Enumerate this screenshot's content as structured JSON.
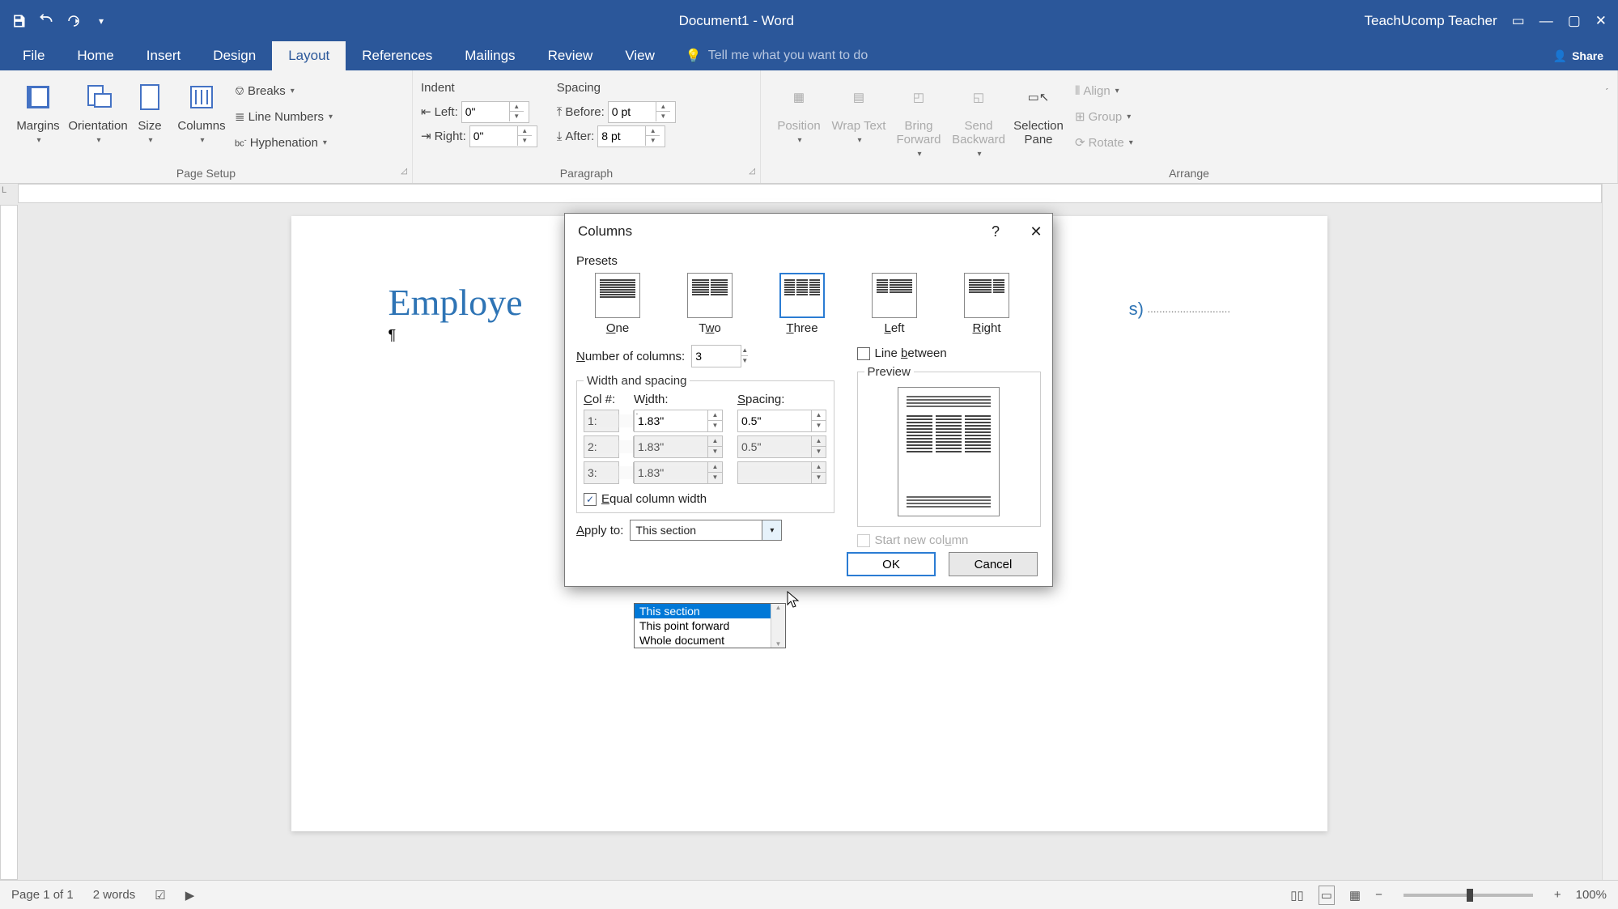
{
  "titlebar": {
    "document_title": "Document1 - Word",
    "user": "TeachUcomp Teacher"
  },
  "tabs": {
    "file": "File",
    "home": "Home",
    "insert": "Insert",
    "design": "Design",
    "layout": "Layout",
    "references": "References",
    "mailings": "Mailings",
    "review": "Review",
    "view": "View"
  },
  "tellme": "Tell me what you want to do",
  "share": "Share",
  "ribbon": {
    "page_setup": {
      "title": "Page Setup",
      "margins": "Margins",
      "orientation": "Orientation",
      "size": "Size",
      "columns": "Columns",
      "breaks": "Breaks",
      "line_numbers": "Line Numbers",
      "hyphenation": "Hyphenation"
    },
    "paragraph": {
      "title": "Paragraph",
      "indent": "Indent",
      "spacing": "Spacing",
      "left": "Left:",
      "right": "Right:",
      "before": "Before:",
      "after": "After:",
      "left_val": "0\"",
      "right_val": "0\"",
      "before_val": "0 pt",
      "after_val": "8 pt"
    },
    "arrange": {
      "title": "Arrange",
      "position": "Position",
      "wrap": "Wrap Text",
      "bring": "Bring Forward",
      "send": "Send Backward",
      "selection": "Selection Pane",
      "align": "Align",
      "group": "Group",
      "rotate": "Rotate"
    }
  },
  "document": {
    "heading": "Employe",
    "heading_after": "s)"
  },
  "status": {
    "page": "Page 1 of 1",
    "words": "2 words",
    "zoom": "100%"
  },
  "dialog": {
    "title": "Columns",
    "presets_label": "Presets",
    "presets": {
      "one": "One",
      "two": "Two",
      "three": "Three",
      "left": "Left",
      "right": "Right"
    },
    "num_cols_label": "Number of columns:",
    "num_cols_val": "3",
    "line_between": "Line between",
    "width_spacing": "Width and spacing",
    "col_hdr": "Col #:",
    "width_hdr": "Width:",
    "spacing_hdr": "Spacing:",
    "rows": [
      {
        "n": "1:",
        "w": "1.83\"",
        "s": "0.5\""
      },
      {
        "n": "2:",
        "w": "1.83\"",
        "s": "0.5\""
      },
      {
        "n": "3:",
        "w": "1.83\"",
        "s": ""
      }
    ],
    "equal": "Equal column width",
    "preview_label": "Preview",
    "apply_to": "Apply to:",
    "apply_val": "This section",
    "start_new": "Start new column",
    "ok": "OK",
    "cancel": "Cancel",
    "options": {
      "a": "This section",
      "b": "This point forward",
      "c": "Whole document"
    }
  }
}
